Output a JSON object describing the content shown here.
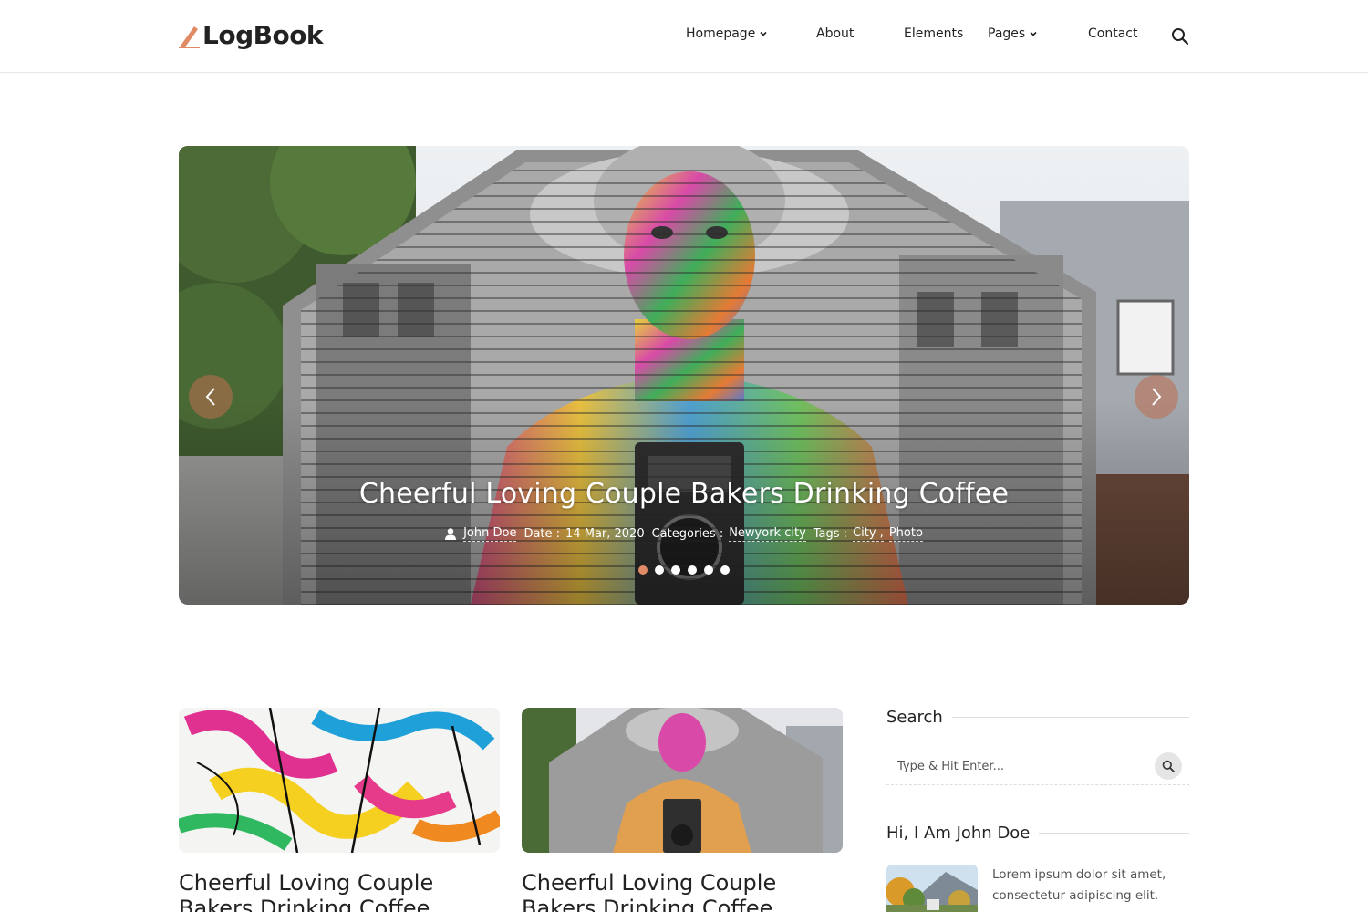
{
  "brand": {
    "name": "LogBook",
    "accent": "#e08b66"
  },
  "nav": {
    "items": [
      {
        "label": "Homepage",
        "has_dropdown": true
      },
      {
        "label": "About",
        "has_dropdown": false
      },
      {
        "label": "Elements",
        "has_dropdown": false
      },
      {
        "label": "Pages",
        "has_dropdown": true
      },
      {
        "label": "Contact",
        "has_dropdown": false
      }
    ],
    "search_icon": "search-icon"
  },
  "hero": {
    "title": "Cheerful Loving Couple Bakers Drinking Coffee",
    "author": "John Doe",
    "date_label": "Date :",
    "date": "14 Mar, 2020",
    "categories_label": "Categories :",
    "category": "Newyork city",
    "tags_label": "Tags :",
    "tags": [
      "City ,",
      "Photo"
    ],
    "slide_count": 6,
    "active_slide": 1
  },
  "posts": [
    {
      "title": "Cheerful Loving Couple Bakers Drinking Coffee"
    },
    {
      "title": "Cheerful Loving Couple Bakers Drinking Coffee"
    }
  ],
  "sidebar": {
    "search_title": "Search",
    "search_placeholder": "Type & Hit Enter...",
    "about_title": "Hi, I Am John Doe",
    "about_text": "Lorem ipsum dolor sit amet, consectetur adipiscing elit."
  }
}
